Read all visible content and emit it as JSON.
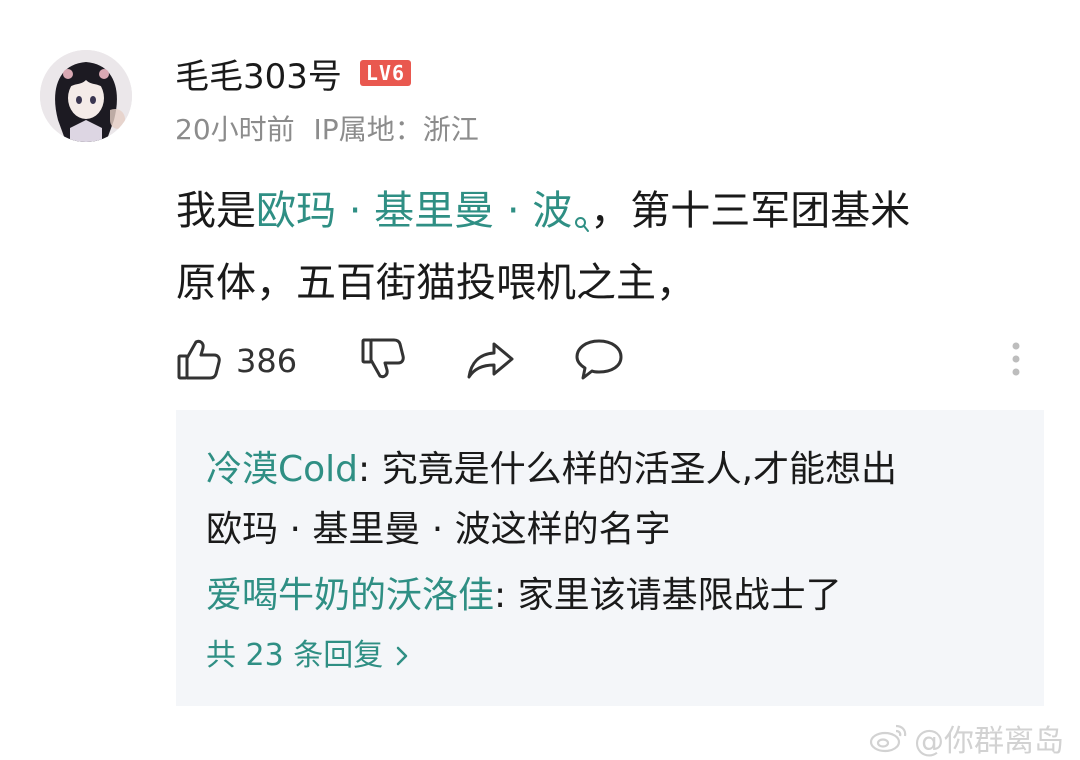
{
  "comment": {
    "username": "毛毛303号",
    "level": "LV6",
    "time": "20小时前",
    "ip_location": "IP属地：浙江",
    "body": {
      "prefix": "我是",
      "link": "欧玛 · 基里曼 · 波",
      "suffix_line1": "，第十三军团基米",
      "line2": "原体，五百街猫投喂机之主，"
    },
    "likes": "386"
  },
  "replies": [
    {
      "author": "冷漠Cold",
      "separator": ": ",
      "text_line1": "究竟是什么样的活圣人,才能想出",
      "text_line2": "欧玛 · 基里曼 · 波这样的名字"
    },
    {
      "author": "爱喝牛奶的沃洛佳",
      "separator": ": ",
      "text": "家里该请基限战士了"
    }
  ],
  "reply_count_label": "共 23 条回复",
  "watermark": "@你群离岛",
  "colors": {
    "link": "#2f8f84",
    "level_badge": "#e9584f",
    "meta": "#8c8c8c",
    "reply_bg": "#f4f6f9"
  },
  "icons": [
    "avatar",
    "like-icon",
    "dislike-icon",
    "share-icon",
    "comment-icon",
    "more-icon",
    "chevron-right-icon",
    "weibo-icon"
  ]
}
